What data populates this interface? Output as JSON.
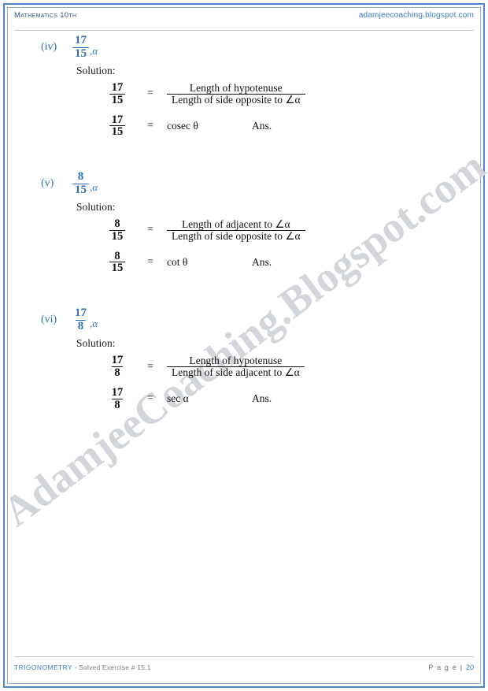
{
  "header": {
    "left": "Mathematics 10th",
    "right": "adamjeecoaching.blogspot.com"
  },
  "watermark": {
    "text": "AdamjeeCoaching.Blogspot.com",
    "color": "#d2d5d9"
  },
  "footer": {
    "title": "TRIGONOMETRY",
    "subtitle": " - Solved Exercise # 15.1",
    "page_label": "P a g e | ",
    "page_number": "20"
  },
  "colors": {
    "accent_blue": "#2e74b5",
    "border_blue": "#4f87c7",
    "header_blue": "#3b7dbd"
  },
  "solution_label": "Solution:",
  "equals_sign": "=",
  "answer_word": "Ans.",
  "problems": [
    {
      "roman": "(iv)",
      "numerator": "17",
      "denominator": "15",
      "angle": ",α",
      "rhs_numerator": "Length of hypotenuse",
      "rhs_denominator": "Length of side opposite to ∠α",
      "answer": "cosec θ"
    },
    {
      "roman": "(v)",
      "numerator": "8",
      "denominator": "15",
      "angle": ",α",
      "rhs_numerator": "Length of adjacent to ∠α",
      "rhs_denominator": "Length of side opposite to ∠α",
      "answer": "cot θ"
    },
    {
      "roman": "(vi)",
      "numerator": "17",
      "denominator": "8",
      "angle": ",α",
      "rhs_numerator": "Length of hypotenuse",
      "rhs_denominator": "Length of side adjacent to ∠α",
      "answer": "sec α"
    }
  ]
}
